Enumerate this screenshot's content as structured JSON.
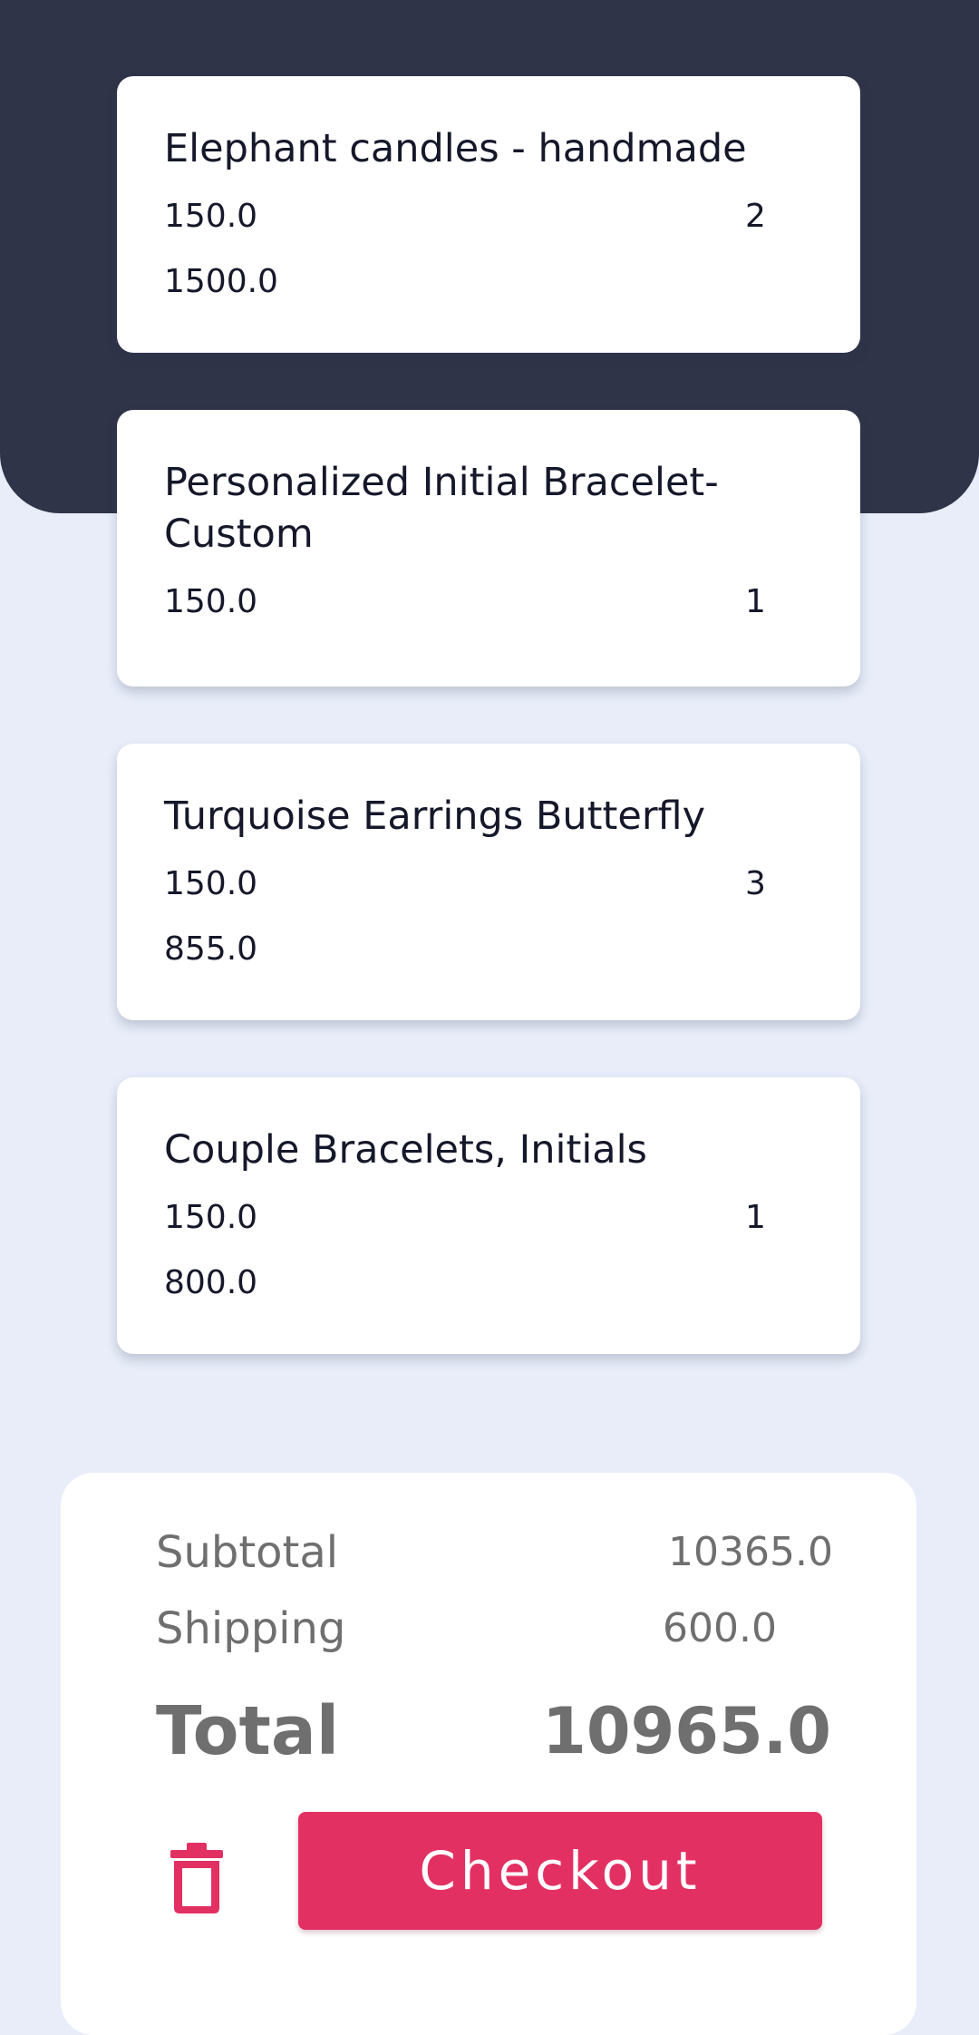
{
  "cart": {
    "items": [
      {
        "name": "Elephant candles - handmade",
        "price": "150.0",
        "quantity": "2",
        "total": "1500.0"
      },
      {
        "name": "Personalized Initial Bracelet-Custom",
        "price": "150.0",
        "quantity": "1",
        "total": ""
      },
      {
        "name": "Turquoise Earrings Butterfly",
        "price": "150.0",
        "quantity": "3",
        "total": "855.0"
      },
      {
        "name": "Couple Bracelets, Initials",
        "price": "150.0",
        "quantity": "1",
        "total": "800.0"
      }
    ]
  },
  "summary": {
    "subtotal_label": "Subtotal",
    "subtotal_value": "10365.0",
    "shipping_label": "Shipping",
    "shipping_value": "600.0",
    "total_label": "Total",
    "total_value": "10965.0",
    "delete_icon": "trash-icon",
    "checkout_label": "Checkout"
  },
  "colors": {
    "header": "#2f3448",
    "background": "#e8edf9",
    "accent": "#e33063",
    "text_dark": "#15182a",
    "text_muted": "#6f6f6f"
  }
}
